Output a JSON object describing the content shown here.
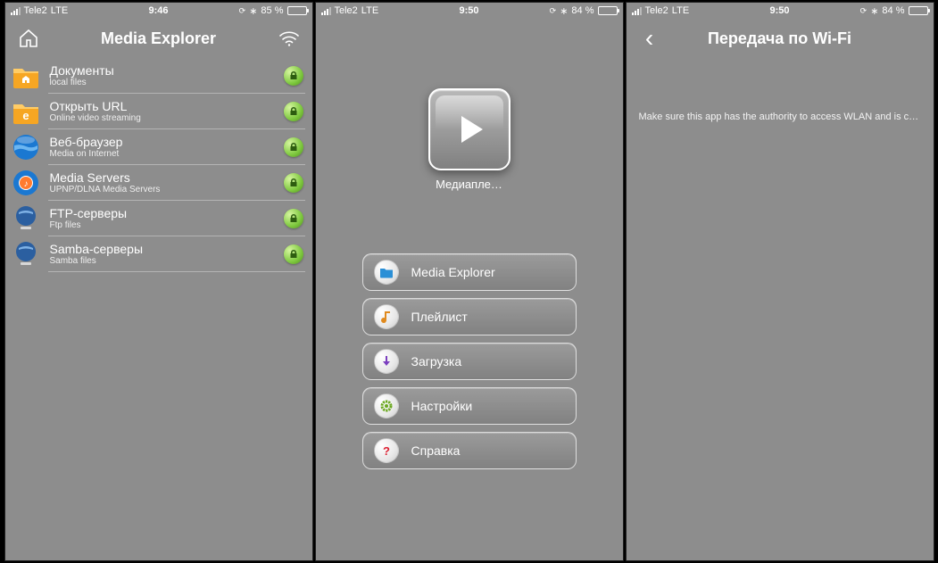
{
  "status": {
    "carrier": "Tele2",
    "network": "LTE",
    "battery_icon": true
  },
  "screen1": {
    "time": "9:46",
    "battery_pct": "85 %",
    "title": "Media Explorer",
    "rows": [
      {
        "title": "Документы",
        "sub": "local files"
      },
      {
        "title": "Открыть URL",
        "sub": "Online video streaming"
      },
      {
        "title": "Веб-браузер",
        "sub": "Media on Internet"
      },
      {
        "title": "Media Servers",
        "sub": "UPNP/DLNA Media Servers"
      },
      {
        "title": "FTP-серверы",
        "sub": "Ftp files"
      },
      {
        "title": "Samba-серверы",
        "sub": "Samba files"
      }
    ]
  },
  "screen2": {
    "time": "9:50",
    "battery_pct": "84 %",
    "app_label": "Медиапле…",
    "menu": [
      {
        "label": "Media Explorer"
      },
      {
        "label": "Плейлист"
      },
      {
        "label": "Загрузка"
      },
      {
        "label": "Настройки"
      },
      {
        "label": "Справка"
      }
    ]
  },
  "screen3": {
    "time": "9:50",
    "battery_pct": "84 %",
    "title": "Передача по Wi-Fi",
    "info": "Make sure this app has the authority to access WLAN and is connected to…"
  }
}
